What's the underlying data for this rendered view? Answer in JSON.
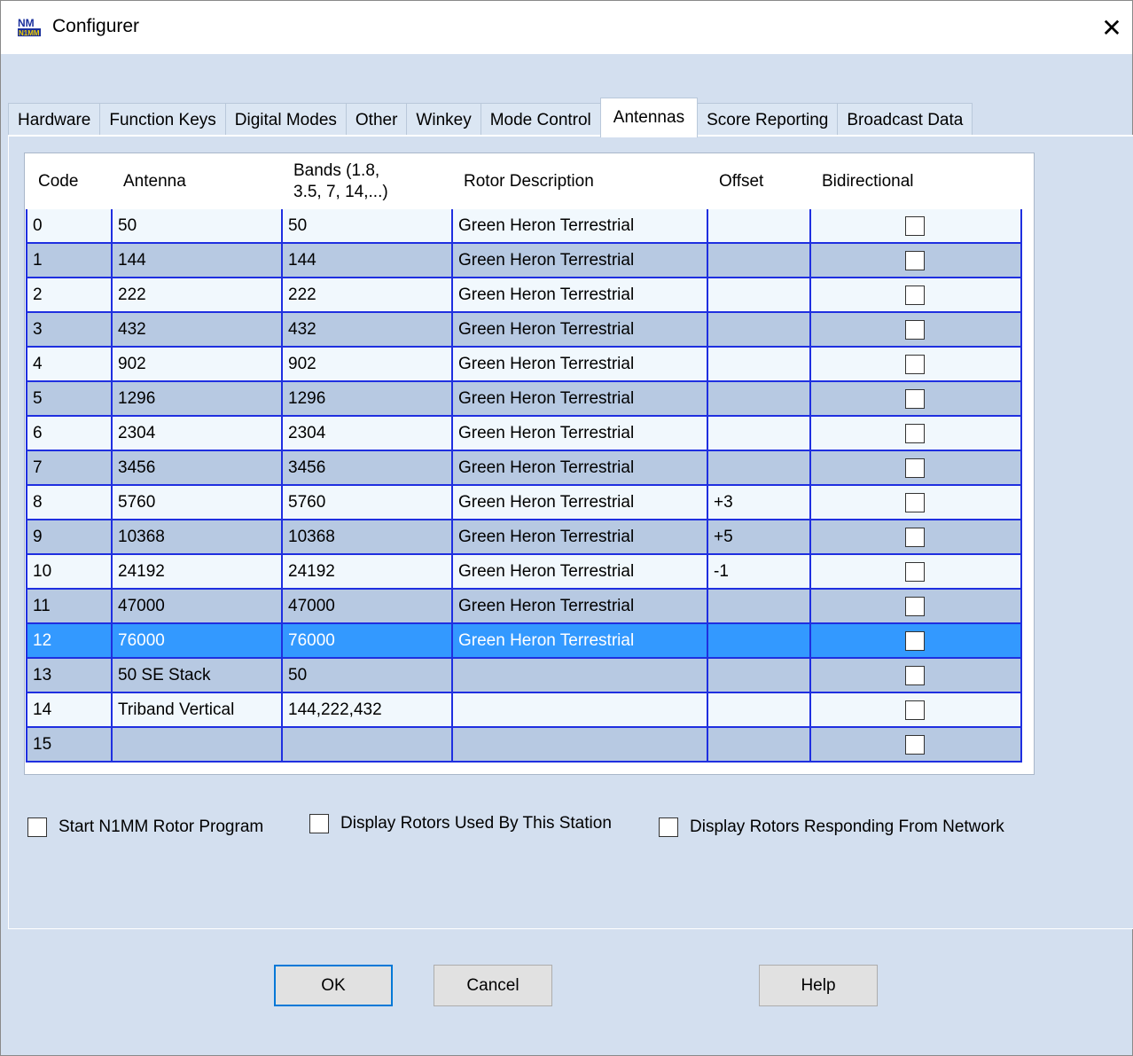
{
  "window": {
    "title": "Configurer",
    "app_icon": "n1mm-logo-icon",
    "close_glyph": "✕"
  },
  "tabs": [
    {
      "label": "Hardware",
      "active": false
    },
    {
      "label": "Function Keys",
      "active": false
    },
    {
      "label": "Digital Modes",
      "active": false
    },
    {
      "label": "Other",
      "active": false
    },
    {
      "label": "Winkey",
      "active": false
    },
    {
      "label": "Mode Control",
      "active": false
    },
    {
      "label": "Antennas",
      "active": true
    },
    {
      "label": "Score Reporting",
      "active": false
    },
    {
      "label": "Broadcast Data",
      "active": false
    }
  ],
  "grid": {
    "columns": [
      "Code",
      "Antenna",
      "Bands (1.8,\n3.5, 7, 14,...)",
      "Rotor Description",
      "Offset",
      "Bidirectional"
    ],
    "rows": [
      {
        "code": "0",
        "antenna": "50",
        "bands": "50",
        "rotor": "Green Heron Terrestrial",
        "offset": "",
        "bidirectional": false
      },
      {
        "code": "1",
        "antenna": "144",
        "bands": "144",
        "rotor": "Green Heron Terrestrial",
        "offset": "",
        "bidirectional": false
      },
      {
        "code": "2",
        "antenna": "222",
        "bands": "222",
        "rotor": "Green Heron Terrestrial",
        "offset": "",
        "bidirectional": false
      },
      {
        "code": "3",
        "antenna": "432",
        "bands": "432",
        "rotor": "Green Heron Terrestrial",
        "offset": "",
        "bidirectional": false
      },
      {
        "code": "4",
        "antenna": "902",
        "bands": "902",
        "rotor": "Green Heron Terrestrial",
        "offset": "",
        "bidirectional": false
      },
      {
        "code": "5",
        "antenna": "1296",
        "bands": "1296",
        "rotor": "Green Heron Terrestrial",
        "offset": "",
        "bidirectional": false
      },
      {
        "code": "6",
        "antenna": "2304",
        "bands": "2304",
        "rotor": "Green Heron Terrestrial",
        "offset": "",
        "bidirectional": false
      },
      {
        "code": "7",
        "antenna": "3456",
        "bands": "3456",
        "rotor": "Green Heron Terrestrial",
        "offset": "",
        "bidirectional": false
      },
      {
        "code": "8",
        "antenna": "5760",
        "bands": "5760",
        "rotor": "Green Heron Terrestrial",
        "offset": "+3",
        "bidirectional": false
      },
      {
        "code": "9",
        "antenna": "10368",
        "bands": "10368",
        "rotor": "Green Heron Terrestrial",
        "offset": "+5",
        "bidirectional": false
      },
      {
        "code": "10",
        "antenna": "24192",
        "bands": "24192",
        "rotor": "Green Heron Terrestrial",
        "offset": "-1",
        "bidirectional": false
      },
      {
        "code": "11",
        "antenna": "47000",
        "bands": "47000",
        "rotor": "Green Heron Terrestrial",
        "offset": "",
        "bidirectional": false
      },
      {
        "code": "12",
        "antenna": "76000",
        "bands": "76000",
        "rotor": "Green Heron Terrestrial",
        "offset": "",
        "bidirectional": false,
        "selected": true
      },
      {
        "code": "13",
        "antenna": "50 SE Stack",
        "bands": "50",
        "rotor": "",
        "offset": "",
        "bidirectional": false
      },
      {
        "code": "14",
        "antenna": "Triband Vertical",
        "bands": "144,222,432",
        "rotor": "",
        "offset": "",
        "bidirectional": false
      },
      {
        "code": "15",
        "antenna": "",
        "bands": "",
        "rotor": "",
        "offset": "",
        "bidirectional": false
      }
    ]
  },
  "options": {
    "start_rotor": {
      "label": "Start N1MM Rotor Program",
      "checked": false
    },
    "display_used": {
      "label": "Display Rotors Used By This Station",
      "checked": false
    },
    "display_network": {
      "label": "Display Rotors Responding From Network",
      "checked": false
    }
  },
  "buttons": {
    "ok": "OK",
    "cancel": "Cancel",
    "help": "Help"
  },
  "colors": {
    "grid_line": "#1f2fe0",
    "row_alt": "#b7c9e2",
    "row_light": "#f1f8fd",
    "selection": "#3399ff",
    "dialog_bg": "#d3dfef"
  }
}
